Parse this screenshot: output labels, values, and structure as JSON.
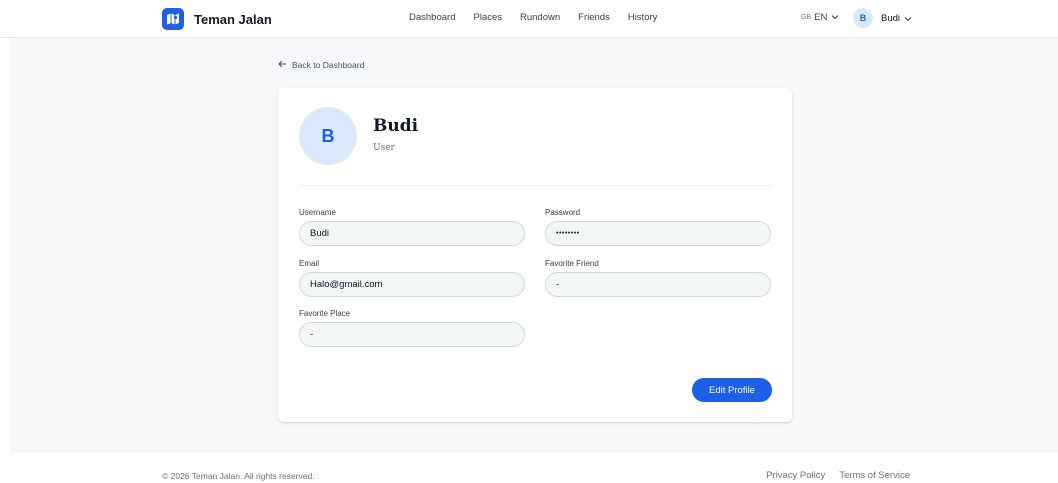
{
  "app": {
    "name": "Teman Jalan"
  },
  "nav": {
    "items": [
      {
        "label": "Dashboard"
      },
      {
        "label": "Places"
      },
      {
        "label": "Rundown"
      },
      {
        "label": "Friends"
      },
      {
        "label": "History"
      }
    ]
  },
  "language": {
    "flag": "GB",
    "code": "EN"
  },
  "user_menu": {
    "initial": "B",
    "name": "Budi"
  },
  "back_link": {
    "label": "Back to Dashboard"
  },
  "profile": {
    "initial": "B",
    "name": "Budi",
    "role": "User",
    "edit_label": "Edit Profile",
    "fields": {
      "username": {
        "label": "Username",
        "value": "Budi"
      },
      "password": {
        "label": "Password",
        "value": "••••••••"
      },
      "email": {
        "label": "Email",
        "value": "Halo@gmail.com"
      },
      "favorite_friend": {
        "label": "Favorite Friend",
        "value": "-"
      },
      "favorite_place": {
        "label": "Favorite Place",
        "value": "-"
      }
    }
  },
  "footer": {
    "copyright": "© 2026 Teman Jalan. All rights reserved.",
    "links": [
      {
        "label": "Privacy Policy"
      },
      {
        "label": "Terms of Service"
      }
    ]
  },
  "colors": {
    "accent": "#1d5fe6",
    "avatar_bg": "#dbe7fb",
    "page_bg": "#f6f8fa"
  },
  "icons": {
    "logo": "map-icon",
    "back": "arrow-left-icon",
    "dropdown": "chevron-down-icon"
  }
}
